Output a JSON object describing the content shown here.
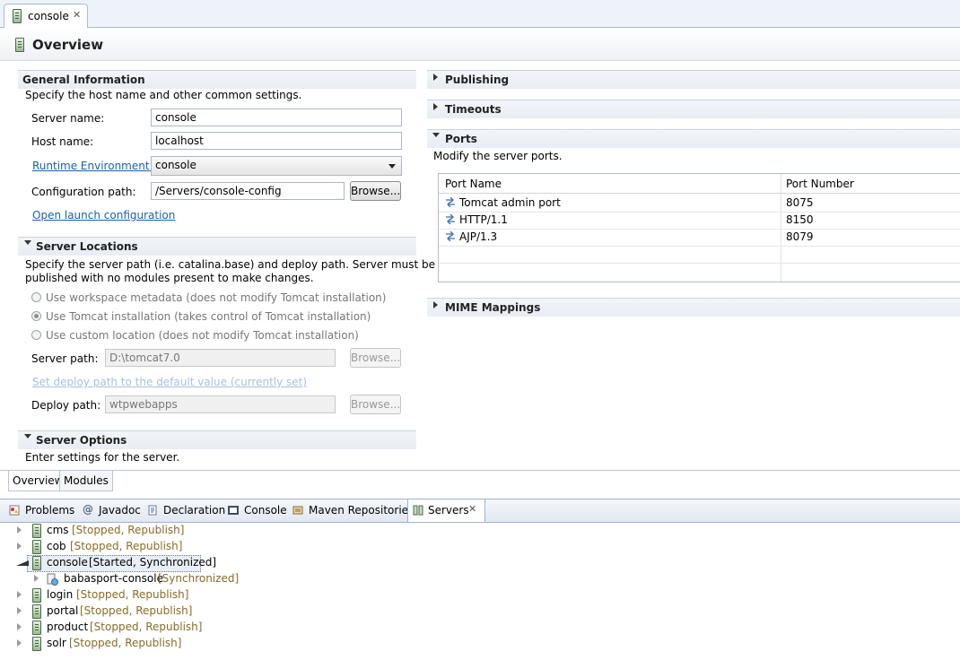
{
  "editor_tab": {
    "label": "console",
    "close": "✕"
  },
  "header": {
    "title": "Overview"
  },
  "general": {
    "title": "General Information",
    "desc": "Specify the host name and other common settings.",
    "server_name_label": "Server name:",
    "server_name_value": "console",
    "host_name_label": "Host name:",
    "host_name_value": "localhost",
    "runtime_label": "Runtime Environment:",
    "runtime_value": "console",
    "config_label": "Configuration path:",
    "config_value": "/Servers/console-config",
    "browse_label": "Browse...",
    "launch_link": "Open launch configuration"
  },
  "locations": {
    "title": "Server Locations",
    "desc_line1": "Specify the server path (i.e. catalina.base) and deploy path. Server must be",
    "desc_line2": "published with no modules present to make changes.",
    "opt1": "Use workspace metadata (does not modify Tomcat installation)",
    "opt2": "Use Tomcat installation (takes control of Tomcat installation)",
    "opt3": "Use custom location (does not modify Tomcat installation)",
    "selected_option": 2,
    "server_path_label": "Server path:",
    "server_path_value": "D:\\tomcat7.0",
    "browse_label": "Browse...",
    "default_link": "Set deploy path to the default value (currently set)",
    "deploy_path_label": "Deploy path:",
    "deploy_path_value": "wtpwebapps"
  },
  "options": {
    "title": "Server Options",
    "desc": "Enter settings for the server."
  },
  "right": {
    "publishing": "Publishing",
    "timeouts": "Timeouts",
    "ports_title": "Ports",
    "ports_desc": "Modify the server ports.",
    "mime": "MIME Mappings"
  },
  "ports_table": {
    "headers": [
      "Port Name",
      "Port Number"
    ],
    "rows": [
      {
        "name": "Tomcat admin port",
        "number": "8075"
      },
      {
        "name": "HTTP/1.1",
        "number": "8150"
      },
      {
        "name": "AJP/1.3",
        "number": "8079"
      }
    ]
  },
  "bottom_tabs": [
    "Overview",
    "Modules"
  ],
  "views": [
    "Problems",
    "Javadoc",
    "Declaration",
    "Console",
    "Maven Repositories",
    "Servers"
  ],
  "servers": [
    {
      "name": "cms",
      "state": "[Stopped, Republish]"
    },
    {
      "name": "cob",
      "state": "[Stopped, Republish]"
    },
    {
      "name": "console",
      "state": "[Started, Synchronized]"
    },
    {
      "name": "babasport-console",
      "state": "[Synchronized]"
    },
    {
      "name": "login",
      "state": "[Stopped, Republish]"
    },
    {
      "name": "portal",
      "state": "[Stopped, Republish]"
    },
    {
      "name": "product",
      "state": "[Stopped, Republish]"
    },
    {
      "name": "solr",
      "state": "[Stopped, Republish]"
    }
  ],
  "colors": {
    "link": "#1b5fa8",
    "state": "#8a6a2a",
    "accent": "#a7bcd6"
  }
}
